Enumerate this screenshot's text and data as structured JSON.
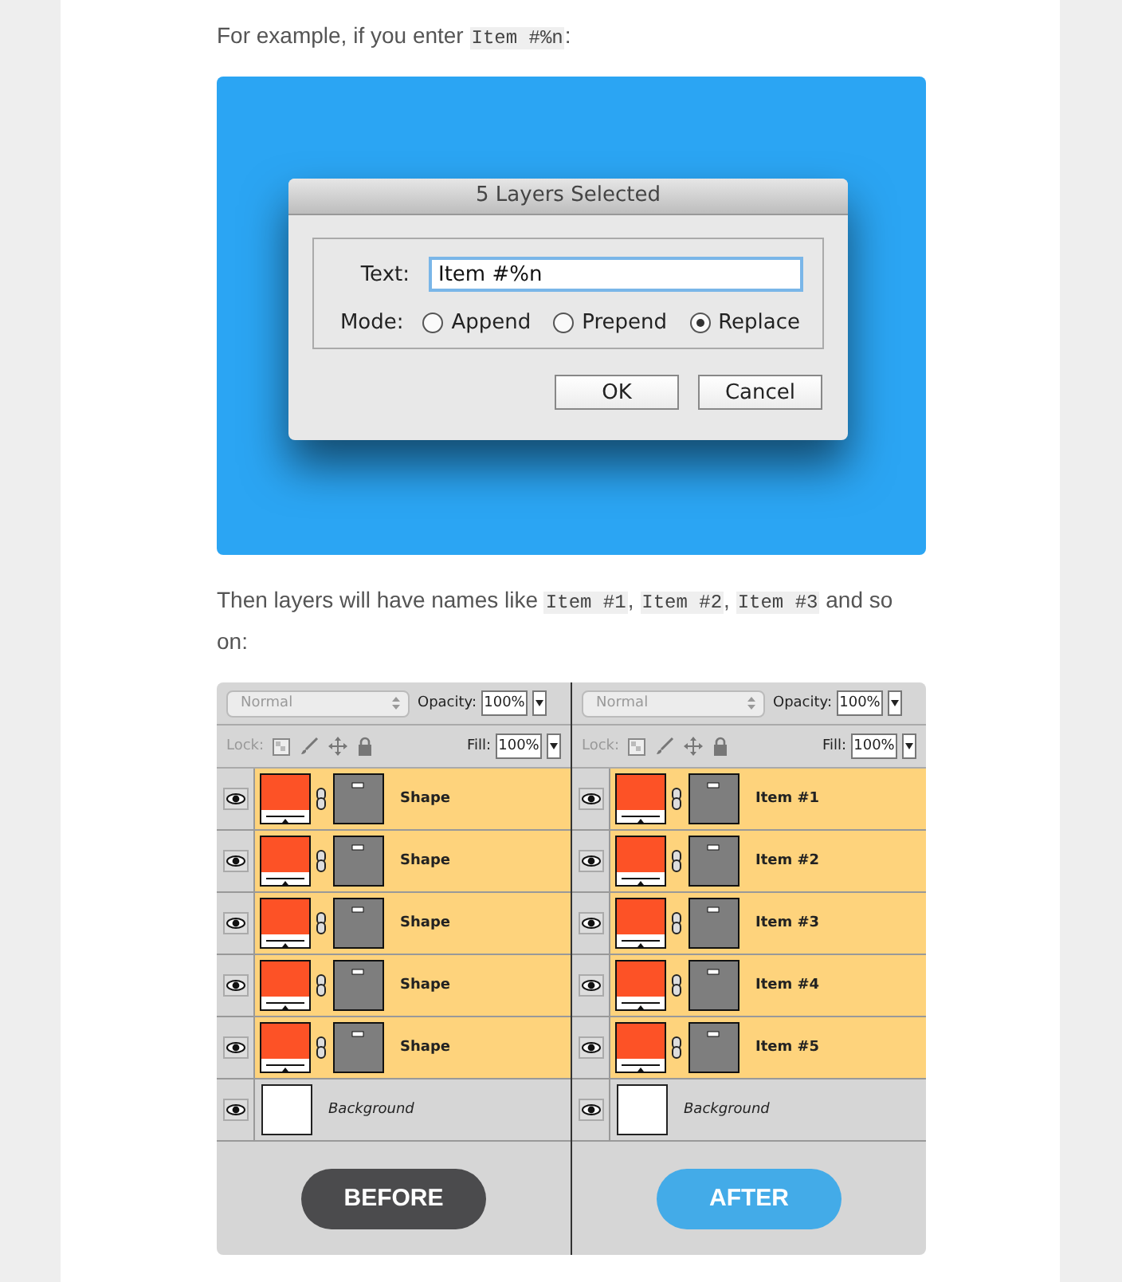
{
  "intro": [
    {
      "kind": "text",
      "text": "For example, if you enter "
    },
    {
      "kind": "code",
      "text": "Item #%n"
    },
    {
      "kind": "text",
      "text": ":"
    }
  ],
  "dialog": {
    "title": "5 Layers Selected",
    "text_label": "Text:",
    "text_value": "Item #%n",
    "mode_label": "Mode:",
    "modes": [
      {
        "label": "Append",
        "selected": false
      },
      {
        "label": "Prepend",
        "selected": false
      },
      {
        "label": "Replace",
        "selected": true
      }
    ],
    "buttons": [
      "OK",
      "Cancel"
    ]
  },
  "outro": [
    {
      "kind": "text",
      "text": "Then layers will have names like "
    },
    {
      "kind": "code",
      "text": "Item #1"
    },
    {
      "kind": "text",
      "text": ", "
    },
    {
      "kind": "code",
      "text": "Item #2"
    },
    {
      "kind": "text",
      "text": ", "
    },
    {
      "kind": "code",
      "text": "Item #3"
    },
    {
      "kind": "text",
      "text": " and so on:"
    }
  ],
  "panels": [
    {
      "blend_mode": "Normal",
      "opacity_label": "Opacity:",
      "opacity": "100%",
      "lock_label": "Lock:",
      "fill_label": "Fill:",
      "fill": "100%",
      "layers": [
        {
          "kind": "shape",
          "name": "Shape",
          "selected": true
        },
        {
          "kind": "shape",
          "name": "Shape",
          "selected": true
        },
        {
          "kind": "shape",
          "name": "Shape",
          "selected": true
        },
        {
          "kind": "shape",
          "name": "Shape",
          "selected": true
        },
        {
          "kind": "shape",
          "name": "Shape",
          "selected": true
        },
        {
          "kind": "background",
          "name": "Background",
          "selected": false
        }
      ],
      "badge": {
        "kind": "before",
        "label": "BEFORE"
      }
    },
    {
      "blend_mode": "Normal",
      "opacity_label": "Opacity:",
      "opacity": "100%",
      "lock_label": "Lock:",
      "fill_label": "Fill:",
      "fill": "100%",
      "layers": [
        {
          "kind": "shape",
          "name": "Item #1",
          "selected": true
        },
        {
          "kind": "shape",
          "name": "Item #2",
          "selected": true
        },
        {
          "kind": "shape",
          "name": "Item #3",
          "selected": true
        },
        {
          "kind": "shape",
          "name": "Item #4",
          "selected": true
        },
        {
          "kind": "shape",
          "name": "Item #5",
          "selected": true
        },
        {
          "kind": "background",
          "name": "Background",
          "selected": false
        }
      ],
      "badge": {
        "kind": "after",
        "label": "AFTER"
      }
    }
  ]
}
